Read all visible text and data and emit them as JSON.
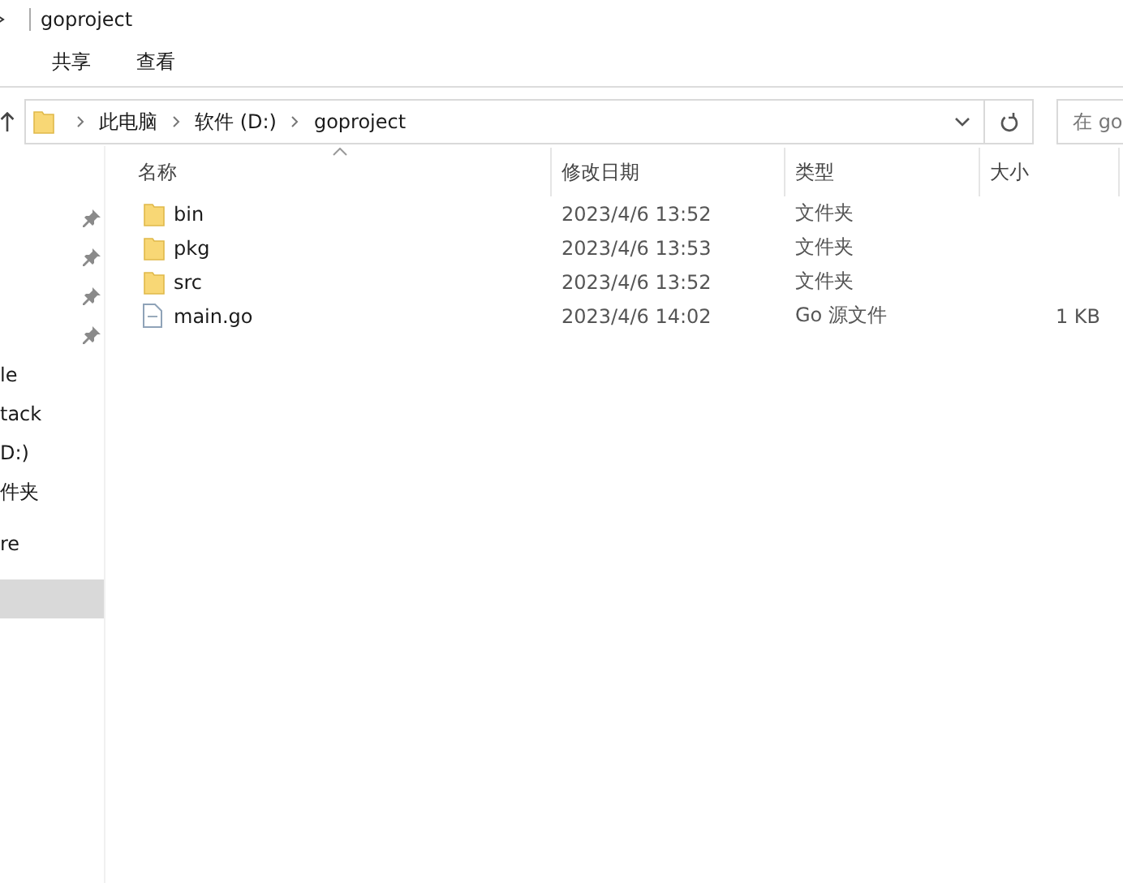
{
  "window": {
    "title": "goproject"
  },
  "ribbon": {
    "tabs": [
      {
        "label": "共享",
        "selected": false
      },
      {
        "label": "查看",
        "selected": false
      }
    ]
  },
  "address_bar": {
    "path": [
      "此电脑",
      "软件 (D:)",
      "goproject"
    ],
    "search": {
      "placeholder": "在 go"
    }
  },
  "sidebar": {
    "items": [
      {
        "pinned": true,
        "selected": false
      },
      {
        "pinned": true,
        "selected": false
      },
      {
        "pinned": true,
        "selected": false
      },
      {
        "pinned": true,
        "selected": false
      },
      {
        "label": "le",
        "pinned": false,
        "selected": false
      },
      {
        "label": "tack",
        "pinned": false,
        "selected": false
      },
      {
        "label": "D:)",
        "pinned": false,
        "selected": false
      },
      {
        "label": "件夹",
        "pinned": false,
        "selected": false
      },
      {
        "label": "re",
        "pinned": false,
        "selected": false
      },
      {
        "pinned": false,
        "selected": true
      }
    ]
  },
  "table": {
    "columns": [
      {
        "label": "名称",
        "sorted": true
      },
      {
        "label": "修改日期",
        "sorted": false
      },
      {
        "label": "类型",
        "sorted": false
      },
      {
        "label": "大小",
        "sorted": false
      }
    ],
    "rows": [
      {
        "kind": "folder",
        "name": "bin",
        "modified": "2023/4/6 13:52",
        "type": "文件夹"
      },
      {
        "kind": "folder",
        "name": "pkg",
        "modified": "2023/4/6 13:53",
        "type": "文件夹"
      },
      {
        "kind": "folder",
        "name": "src",
        "modified": "2023/4/6 13:52",
        "type": "文件夹"
      },
      {
        "kind": "file",
        "name": "main.go",
        "modified": "2023/4/6 14:02",
        "type": "Go 源文件",
        "size": "1 KB"
      }
    ]
  }
}
